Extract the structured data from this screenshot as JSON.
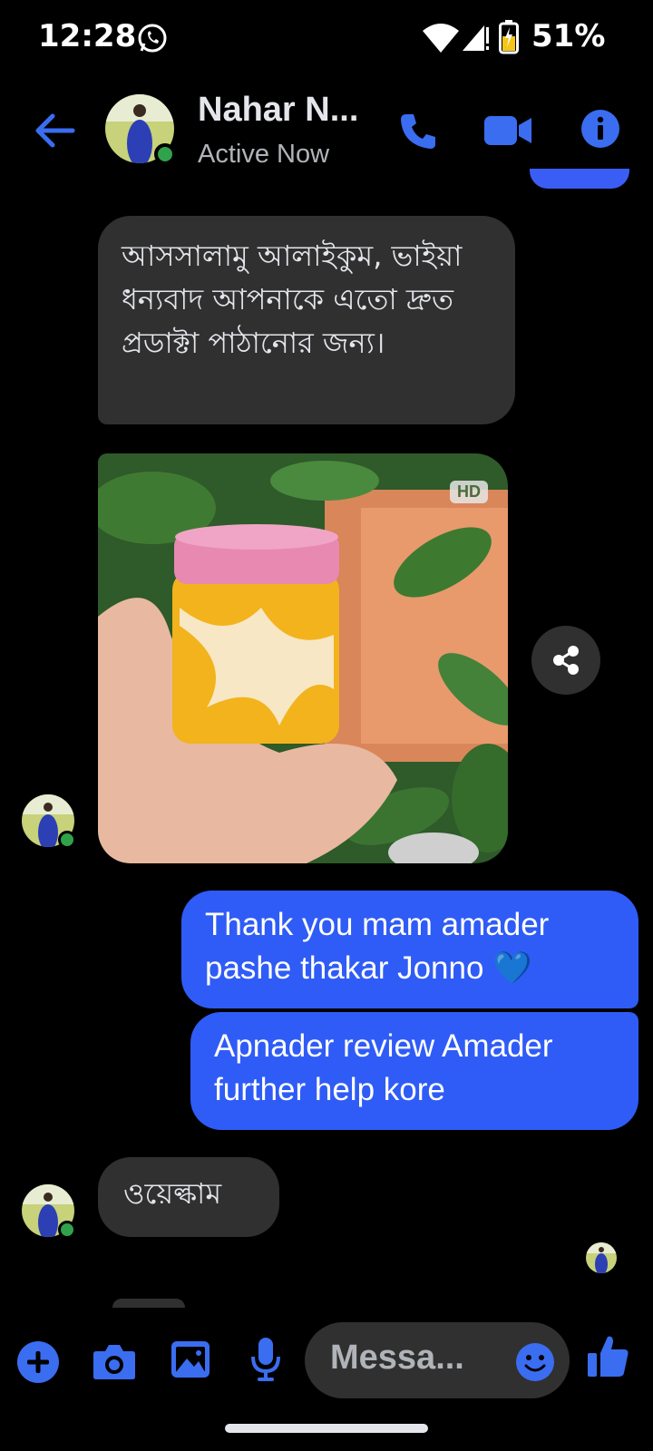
{
  "status_bar": {
    "time": "12:28",
    "battery": "51%"
  },
  "header": {
    "name": "Nahar N...",
    "status": "Active Now"
  },
  "messages": {
    "incoming_1": "আসসালামু আলাইকুম, ভাইয়া ধন্যবাদ আপনাকে এতো দ্রুত প্রডাক্টা পাঠানোর জন্য।",
    "photo_badge": "HD",
    "outgoing_1": "Thank you mam amader pashe thakar Jonno 💙",
    "outgoing_2": "Apnader review Amader further help kore",
    "incoming_2": "ওয়েল্কাম"
  },
  "composer": {
    "placeholder": "Messa..."
  },
  "colors": {
    "accent": "#2f5cf6",
    "icon_blue": "#3a6df0",
    "incoming_bubble": "#303030",
    "online": "#31a24c"
  }
}
